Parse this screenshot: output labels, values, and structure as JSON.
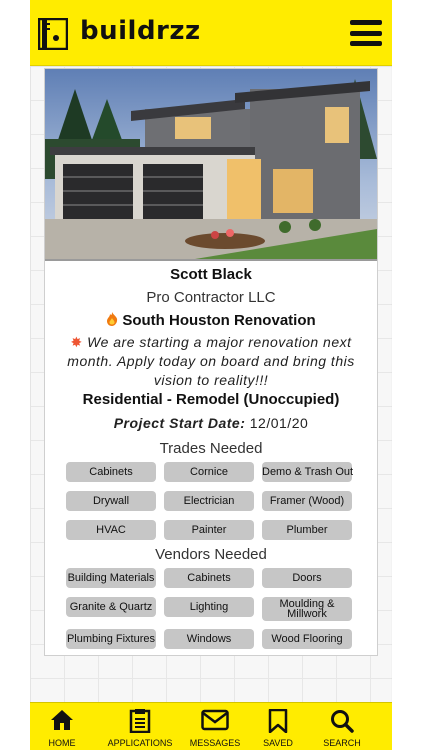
{
  "app": {
    "brand": "buildrzz"
  },
  "header": {
    "menu_icon": "hamburger-icon"
  },
  "post": {
    "name": "Scott Black",
    "company": "Pro Contractor LLC",
    "project_title": "South Houston Renovation",
    "description": "We are starting a major renovation next month. Apply today on board and bring this vision to reality!!!",
    "category": "Residential - Remodel (Unoccupied)",
    "start_date_label": "Project Start Date:",
    "start_date": "12/01/20"
  },
  "trades": {
    "title": "Trades Needed",
    "items": [
      "Cabinets",
      "Cornice",
      "Demo & Trash Out",
      "Drywall",
      "Electrician",
      "Framer (Wood)",
      "HVAC",
      "Painter",
      "Plumber"
    ]
  },
  "vendors": {
    "title": "Vendors Needed",
    "items": [
      "Building Materials",
      "Cabinets",
      "Doors",
      "Granite & Quartz",
      "Lighting",
      "Moulding & Millwork",
      "Plumbing Fixtures",
      "Windows",
      "Wood Flooring"
    ]
  },
  "nav": {
    "items": [
      {
        "label": "HOME",
        "icon": "home-icon"
      },
      {
        "label": "APPLICATIONS",
        "icon": "applications-icon"
      },
      {
        "label": "MESSAGES",
        "icon": "mail-icon"
      },
      {
        "label": "SAVED",
        "icon": "bookmark-icon"
      },
      {
        "label": "SEARCH",
        "icon": "search-icon"
      }
    ]
  },
  "colors": {
    "brand_yellow": "#ffec00",
    "chip_gray": "#c6c6c6"
  }
}
